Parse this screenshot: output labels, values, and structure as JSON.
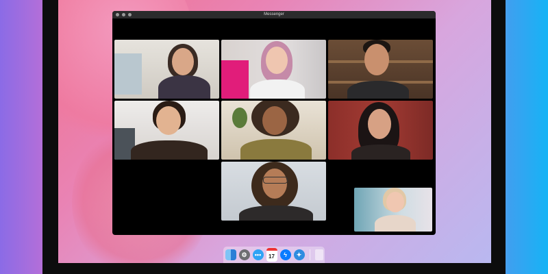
{
  "window": {
    "title": "Messenger"
  },
  "participants": [
    {
      "id": "p1"
    },
    {
      "id": "p2"
    },
    {
      "id": "p3"
    },
    {
      "id": "p4"
    },
    {
      "id": "p5"
    },
    {
      "id": "p6"
    },
    {
      "id": "p7"
    },
    {
      "id": "self"
    }
  ],
  "dock": {
    "items": [
      {
        "icon": "finder-icon"
      },
      {
        "icon": "system-preferences-icon"
      },
      {
        "icon": "messages-icon"
      },
      {
        "icon": "calendar-icon",
        "label": "17"
      },
      {
        "icon": "messenger-icon"
      },
      {
        "icon": "safari-icon"
      },
      {
        "icon": "trash-icon"
      }
    ]
  },
  "colors": {
    "accent": "#0a7cff",
    "window_bg": "#000000",
    "titlebar": "#2b2b2c"
  }
}
